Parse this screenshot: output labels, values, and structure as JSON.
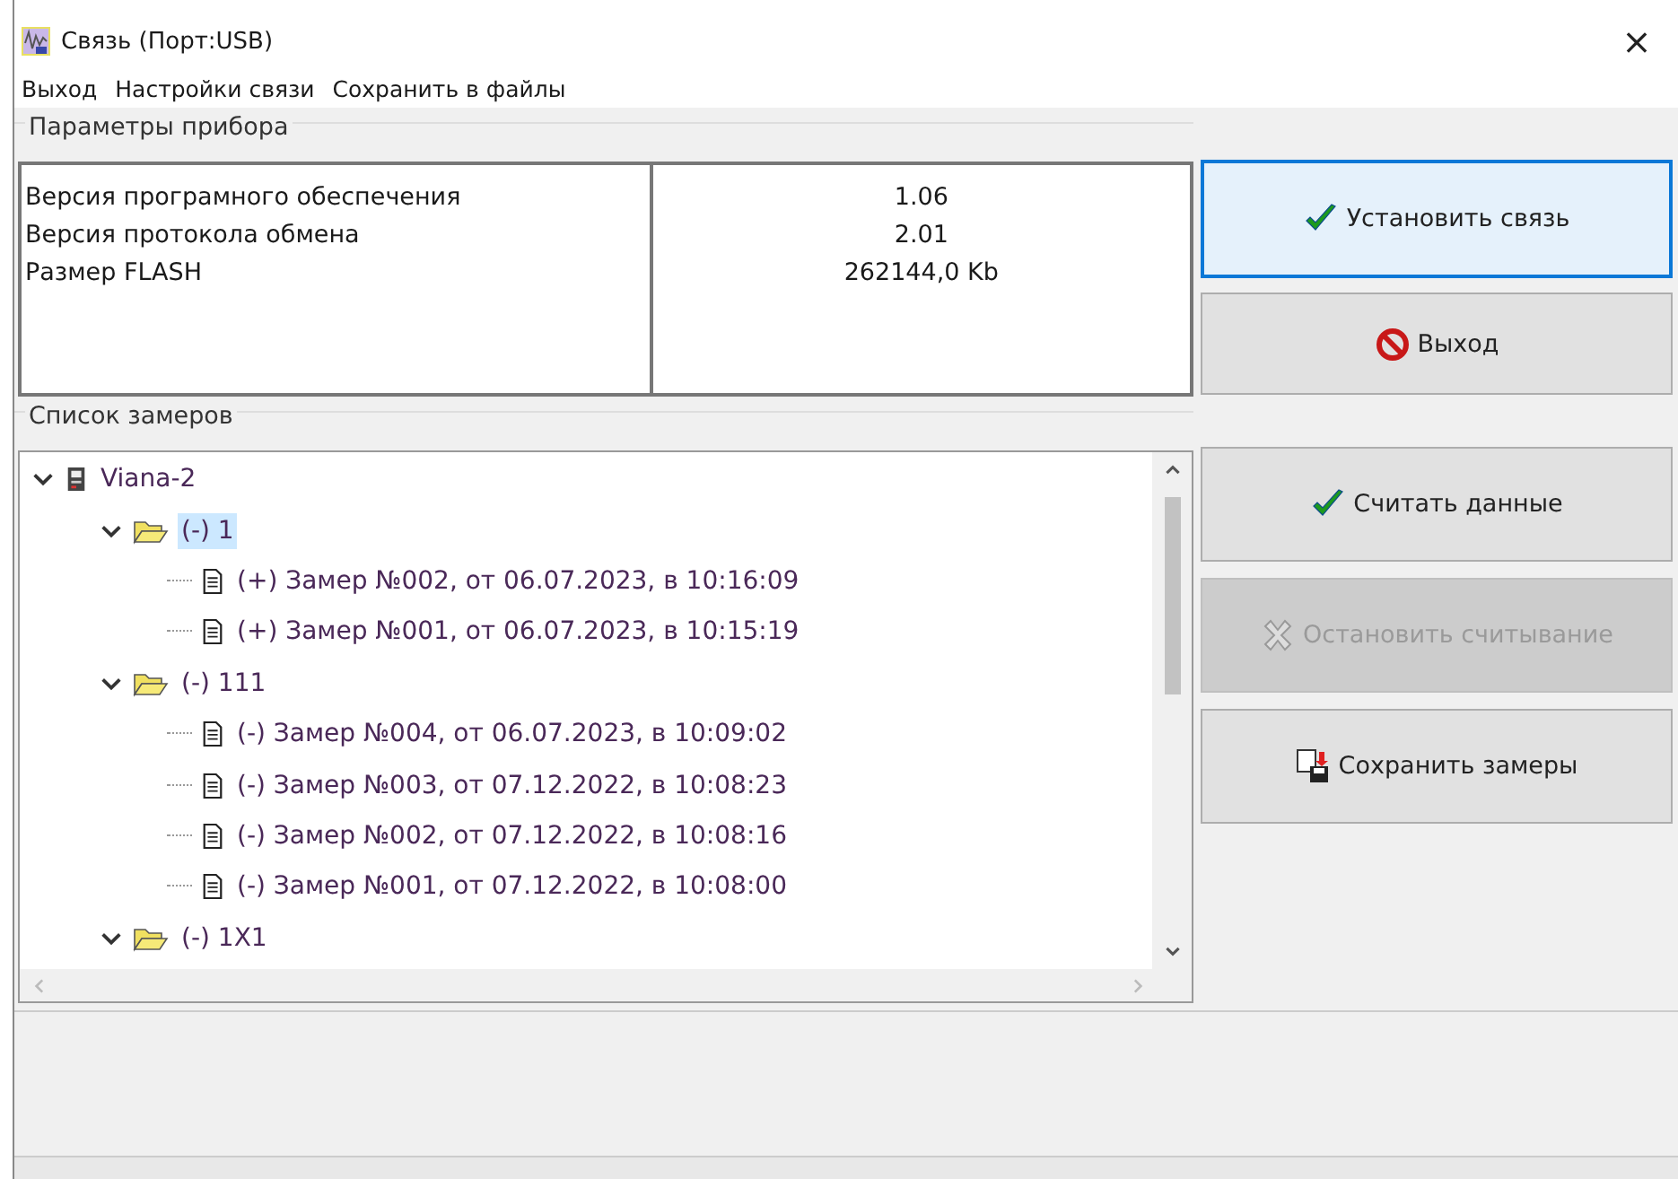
{
  "window": {
    "title": "Связь (Порт:USB)",
    "close": "×"
  },
  "menu": [
    {
      "label": "Выход"
    },
    {
      "label": "Настройки связи"
    },
    {
      "label": "Сохранить в файлы"
    }
  ],
  "device_params": {
    "title": "Параметры прибора",
    "rows": [
      {
        "name": "Версия програмного обеспечения",
        "value": "1.06"
      },
      {
        "name": "Версия протокола обмена",
        "value": "2.01"
      },
      {
        "name": "Размер FLASH",
        "value": "262144,0 Kb"
      }
    ]
  },
  "top_buttons": [
    {
      "label": "Установить связь",
      "kind": "check",
      "default": true,
      "disabled": false
    },
    {
      "label": "Выход",
      "kind": "forbid",
      "default": false,
      "disabled": false
    }
  ],
  "measurements": {
    "title": "Список замеров",
    "tree": [
      {
        "label": "Viana-2",
        "kind": "device",
        "expanded": true,
        "selected": false,
        "children": [
          {
            "label": "(-) 1",
            "kind": "folder",
            "expanded": true,
            "selected": true,
            "children": [
              {
                "label": "(+) Замер №002, от 06.07.2023, в  10:16:09",
                "kind": "file",
                "selected": false
              },
              {
                "label": "(+) Замер №001, от 06.07.2023, в  10:15:19",
                "kind": "file",
                "selected": false
              }
            ]
          },
          {
            "label": "(-) 111",
            "kind": "folder",
            "expanded": true,
            "selected": false,
            "children": [
              {
                "label": "(-) Замер №004, от 06.07.2023, в  10:09:02",
                "kind": "file",
                "selected": false
              },
              {
                "label": "(-) Замер №003, от 07.12.2022, в  10:08:23",
                "kind": "file",
                "selected": false
              },
              {
                "label": "(-) Замер №002, от 07.12.2022, в  10:08:16",
                "kind": "file",
                "selected": false
              },
              {
                "label": "(-) Замер №001, от 07.12.2022, в  10:08:00",
                "kind": "file",
                "selected": false
              }
            ]
          },
          {
            "label": "(-) 1X1",
            "kind": "folder",
            "expanded": true,
            "selected": false
          }
        ]
      }
    ]
  },
  "side_buttons": [
    {
      "label": "Считать данные",
      "kind": "check",
      "default": false,
      "disabled": false
    },
    {
      "label": "Остановить считывание",
      "kind": "cross",
      "default": false,
      "disabled": true
    },
    {
      "label": "Сохранить замеры",
      "kind": "save",
      "default": false,
      "disabled": false
    }
  ]
}
